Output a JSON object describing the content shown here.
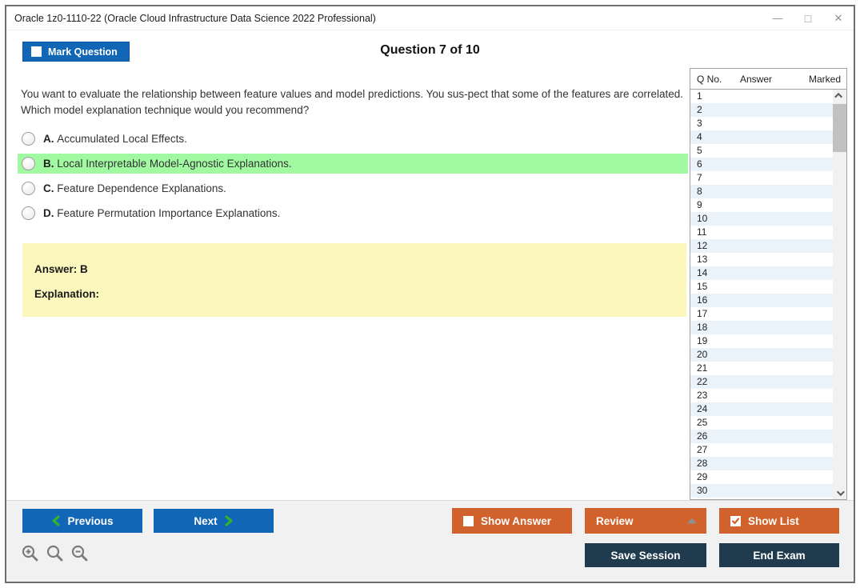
{
  "window": {
    "title": "Oracle 1z0-1110-22 (Oracle Cloud Infrastructure Data Science 2022 Professional)",
    "controls": [
      {
        "name": "minimize",
        "glyph": "—"
      },
      {
        "name": "maximize",
        "glyph": "□"
      },
      {
        "name": "close",
        "glyph": "✕"
      }
    ]
  },
  "header": {
    "mark_question_label": "Mark Question",
    "mark_question_checkbox": "unchecked",
    "question_counter": "Question 7 of 10"
  },
  "question": {
    "text": "You want to evaluate the relationship between feature values and model predictions. You sus-pect that some of the features are correlated. Which model explanation technique would you recommend?",
    "options": [
      {
        "letter": "A.",
        "text": "Accumulated Local Effects.",
        "highlighted": false,
        "selected": false
      },
      {
        "letter": "B.",
        "text": "Local Interpretable Model-Agnostic Explanations.",
        "highlighted": true,
        "selected": false
      },
      {
        "letter": "C.",
        "text": "Feature Dependence Explanations.",
        "highlighted": false,
        "selected": false
      },
      {
        "letter": "D.",
        "text": "Feature Permutation Importance Explanations.",
        "highlighted": false,
        "selected": false
      }
    ]
  },
  "answer_panel": {
    "answer_label": "Answer: B",
    "explanation_label": "Explanation:"
  },
  "question_list": {
    "columns": [
      "Q No.",
      "Answer",
      "Marked"
    ],
    "row_numbers": [
      "1",
      "2",
      "3",
      "4",
      "5",
      "6",
      "7",
      "8",
      "9",
      "10",
      "11",
      "12",
      "13",
      "14",
      "15",
      "16",
      "17",
      "18",
      "19",
      "20",
      "21",
      "22",
      "23",
      "24",
      "25",
      "26",
      "27",
      "28",
      "29",
      "30"
    ]
  },
  "footer": {
    "previous_label": "Previous",
    "next_label": "Next",
    "show_answer_label": "Show Answer",
    "show_answer_checkbox": "unchecked",
    "review_label": "Review",
    "show_list_label": "Show List",
    "show_list_checkbox": "checked",
    "save_session_label": "Save Session",
    "end_exam_label": "End Exam"
  },
  "colors": {
    "primary_blue": "#1166B5",
    "accent_orange": "#D2622B",
    "dark_navy": "#1F3B4D",
    "highlight_green": "#A1FAA1",
    "answer_yellow": "#FCF7BC",
    "alt_row_blue": "#EAF2FA",
    "chevron_green": "#2EB42E",
    "footer_gray": "#F1F1F1"
  }
}
